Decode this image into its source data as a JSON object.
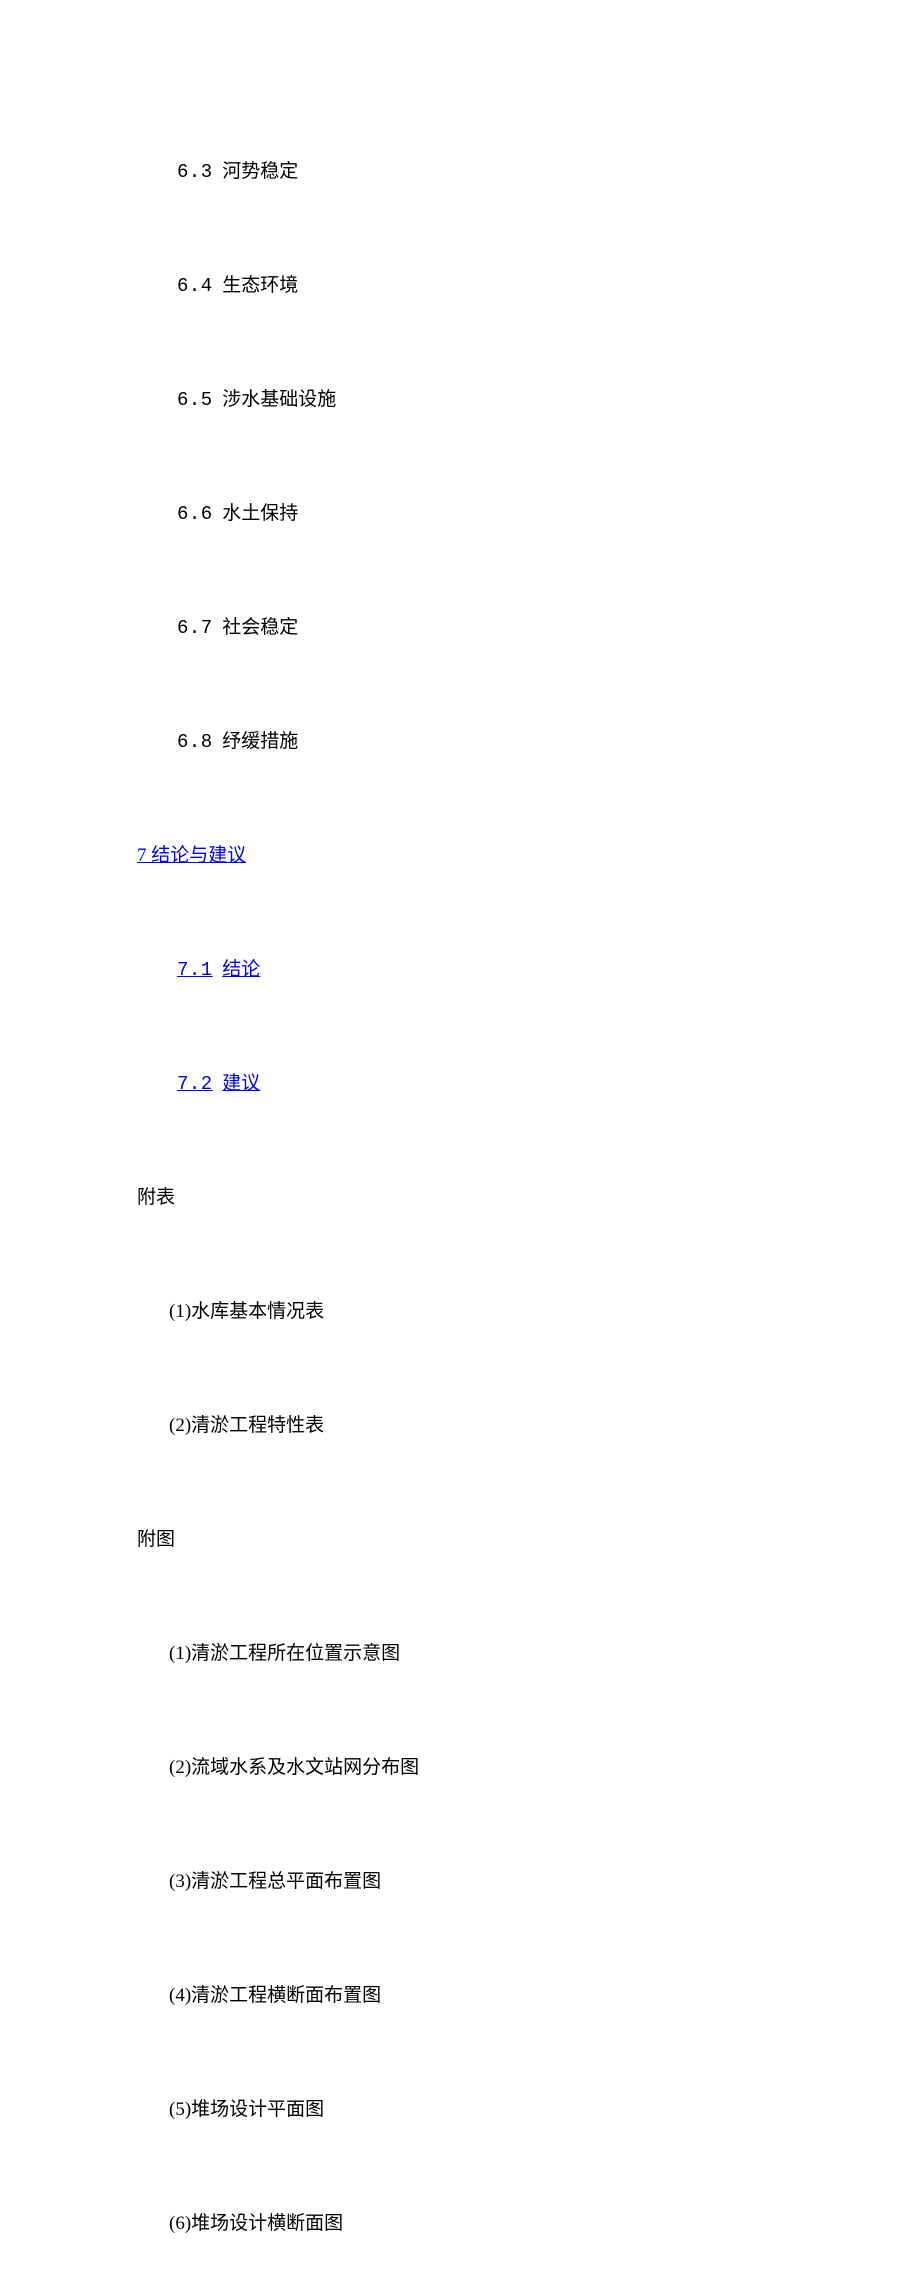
{
  "section6": [
    {
      "num": "6.3",
      "text": "河势稳定"
    },
    {
      "num": "6.4",
      "text": "生态环境"
    },
    {
      "num": "6.5",
      "text": "涉水基础设施"
    },
    {
      "num": "6.6",
      "text": "水土保持"
    },
    {
      "num": "6.7",
      "text": "社会稳定"
    },
    {
      "num": "6.8",
      "text": "纾缓措施"
    }
  ],
  "section7": {
    "title": "7 结论与建议",
    "items": [
      {
        "num": "7.1",
        "text": "结论"
      },
      {
        "num": "7.2",
        "text": "建议"
      }
    ]
  },
  "futable": {
    "title": "附表",
    "items": [
      "(1)水库基本情况表",
      "(2)清淤工程特性表"
    ]
  },
  "futu": {
    "title": "附图",
    "items": [
      "(1)清淤工程所在位置示意图",
      "(2)流域水系及水文站网分布图",
      "(3)清淤工程总平面布置图",
      "(4)清淤工程横断面布置图",
      "(5)堆场设计平面图",
      "(6)堆场设计横断面图"
    ]
  }
}
